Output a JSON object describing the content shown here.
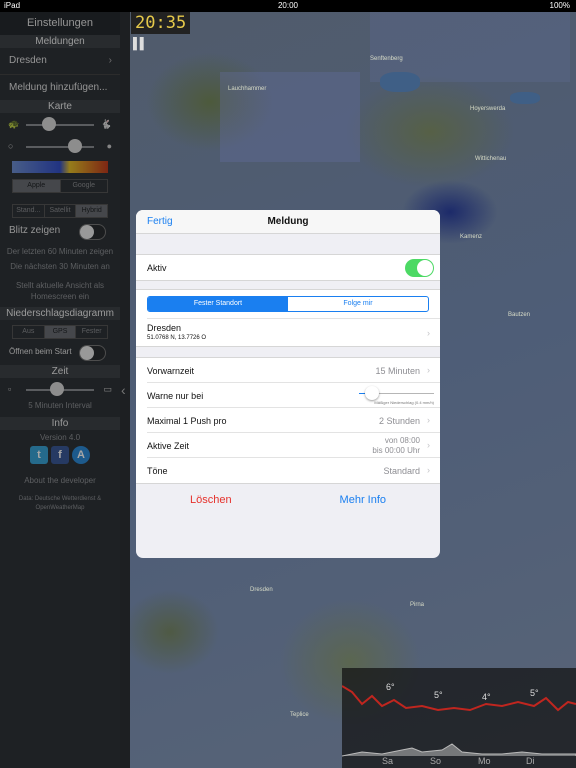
{
  "status_bar": {
    "device": "iPad",
    "time": "20:00",
    "battery": "100%"
  },
  "map": {
    "clock": "20:35",
    "places": [
      "Senftenberg",
      "Lauchhammer",
      "Hoyerswerda",
      "Wittichenau",
      "Bautzen",
      "Kamenz",
      "Dresden",
      "Pirna",
      "Teplice"
    ]
  },
  "sidebar": {
    "title": "Einstellungen",
    "section_alerts": "Meldungen",
    "alert_item": "Dresden",
    "add_alert": "Meldung hinzufügen...",
    "section_map": "Karte",
    "map_provider": [
      "Apple",
      "Google"
    ],
    "map_type": [
      "Stand...",
      "Satellit",
      "Hybrid"
    ],
    "lightning_label": "Blitz zeigen",
    "rain_past": "Der letzten 60 Minuten zeigen",
    "rain_next": "Die nächsten 30 Minuten an",
    "homescreen": "Stellt aktuelle Ansicht als Homescreen ein",
    "section_chart": "Niederschlagsdiagramm",
    "chart_mode": [
      "Aus",
      "GPS",
      "Fester"
    ],
    "open_on_start": "Öffnen beim Start",
    "section_time": "Zeit",
    "interval": "5 Minuten Interval",
    "section_info": "Info",
    "version": "Version 4.0",
    "about": "About the developer",
    "data_source": "Data: Deutsche Wetterdienst & OpenWeatherMap"
  },
  "modal": {
    "done": "Fertig",
    "title": "Meldung",
    "active_label": "Aktiv",
    "active_on": true,
    "seg_fixed": "Fester Standort",
    "seg_follow": "Folge mir",
    "location_name": "Dresden",
    "location_coords": "51.0768 N, 13.7726 O",
    "prewarn_label": "Vorwarnzeit",
    "prewarn_value": "15 Minuten",
    "warn_only_label": "Warne nur bei",
    "warn_only_caption": "Mäßiger Niederschlag (0.4 mm/h)",
    "max_push_label": "Maximal 1 Push pro",
    "max_push_value": "2 Stunden",
    "active_time_label": "Aktive Zeit",
    "active_time_from": "von 08:00",
    "active_time_to": "bis 00:00 Uhr",
    "tones_label": "Töne",
    "tones_value": "Standard",
    "delete": "Löschen",
    "more_info": "Mehr Info"
  },
  "forecast": {
    "temps": [
      "6°",
      "5°",
      "4°",
      "5°"
    ],
    "days": [
      "Sa",
      "So",
      "Mo",
      "Di"
    ]
  }
}
